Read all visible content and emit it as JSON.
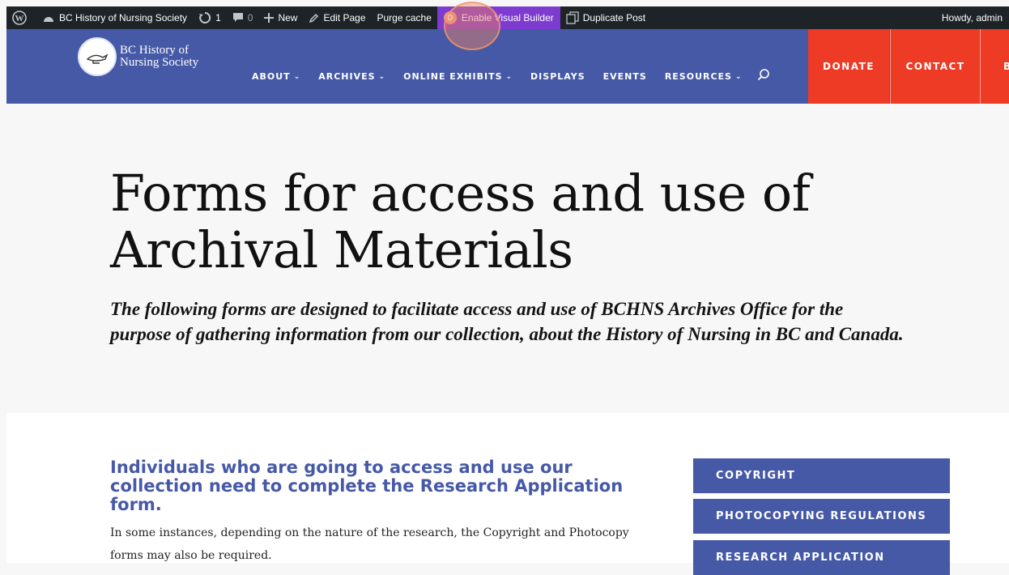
{
  "adminbar": {
    "site_name": "BC History of Nursing Society",
    "updates_count": "1",
    "comments_count": "0",
    "new_label": "New",
    "edit_page_label": "Edit Page",
    "purge_cache_label": "Purge cache",
    "visual_builder_label": "Enable Visual Builder",
    "duplicate_post_label": "Duplicate Post",
    "howdy_label": "Howdy, admin"
  },
  "header": {
    "logo_line1": "BC History of",
    "logo_line2": "Nursing Society",
    "nav": [
      {
        "label": "ABOUT",
        "dropdown": true
      },
      {
        "label": "ARCHIVES",
        "dropdown": true
      },
      {
        "label": "ONLINE EXHIBITS",
        "dropdown": true
      },
      {
        "label": "DISPLAYS",
        "dropdown": false
      },
      {
        "label": "EVENTS",
        "dropdown": false
      },
      {
        "label": "RESOURCES",
        "dropdown": true
      }
    ],
    "donate_label": "DONATE",
    "contact_label": "CONTACT",
    "third_cta_label": "B"
  },
  "hero": {
    "title": "Forms for access and use of Archival Materials",
    "subtitle": "The following forms are designed to facilitate access and use of BCHNS Archives Office for the purpose of gathering information from our collection, about the History of Nursing in BC and Canada."
  },
  "content": {
    "heading": "Individuals who are going to access and use our collection need to complete the Research Application form.",
    "body": "In some instances, depending on the nature of the research, the Copyright and Photocopy forms may also be required.",
    "side_buttons": [
      "COPYRIGHT",
      "PHOTOCOPYING REGULATIONS",
      "RESEARCH APPLICATION"
    ]
  },
  "colors": {
    "admin_bar": "#1d2327",
    "brand_blue": "#4659a7",
    "cta_red": "#ed3b26",
    "visual_builder_purple": "#7e3bd0"
  }
}
